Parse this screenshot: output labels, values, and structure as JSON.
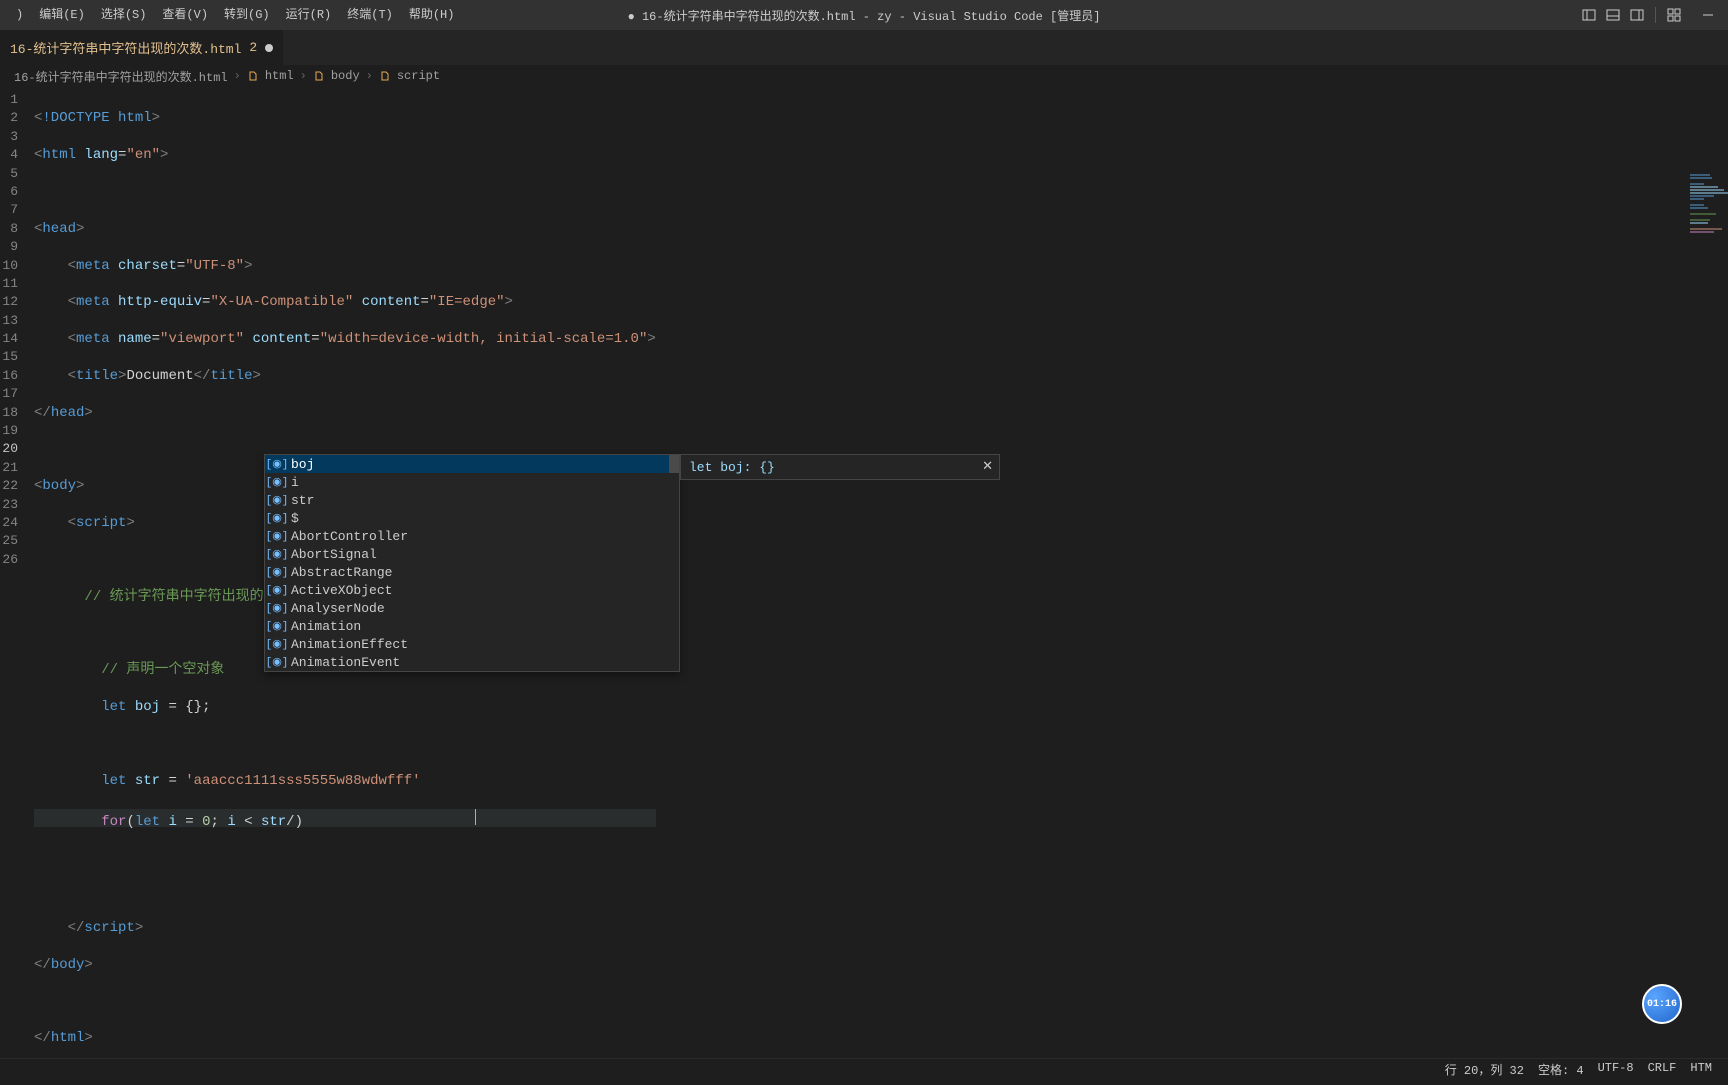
{
  "menu": {
    "items": [
      ")",
      "编辑(E)",
      "选择(S)",
      "查看(V)",
      "转到(G)",
      "运行(R)",
      "终端(T)",
      "帮助(H)"
    ]
  },
  "title": "● 16-统计字符串中字符出现的次数.html - zy - Visual Studio Code [管理员]",
  "tab": {
    "label": "16-统计字符串中字符出现的次数.html",
    "modifiedCount": "2"
  },
  "breadcrumb": {
    "file": "16-统计字符串中字符出现的次数.html",
    "parts": [
      "html",
      "body",
      "script"
    ]
  },
  "lines": [
    "1",
    "2",
    "3",
    "4",
    "5",
    "6",
    "7",
    "8",
    "9",
    "10",
    "11",
    "12",
    "13",
    "14",
    "15",
    "16",
    "17",
    "18",
    "19",
    "20",
    "21",
    "22",
    "23",
    "24",
    "25",
    "26"
  ],
  "code": {
    "doctype": "!DOCTYPE",
    "html": "html",
    "lang": "lang",
    "en": "\"en\"",
    "head": "head",
    "meta": "meta",
    "charset": "charset",
    "utf8": "\"UTF-8\"",
    "httpEquiv": "http-equiv",
    "xua": "\"X-UA-Compatible\"",
    "content": "content",
    "ieedge": "\"IE=edge\"",
    "name": "name",
    "viewport": "\"viewport\"",
    "vpcontent": "\"width=device-width, initial-scale=1.0\"",
    "title": "title",
    "document": "Document",
    "body": "body",
    "script": "script",
    "comment1": "// 统计字符串中字符出现的次数",
    "comment2": "// 声明一个空对象",
    "let": "let",
    "boj": "boj",
    "eqBrace": " = {};",
    "str": "str",
    "strVal": "'aaaccc1111sss5555w88wdwfff'",
    "for": "for",
    "iEq": "i = 0; i < str/",
    "close": ")"
  },
  "suggest": {
    "items": [
      "boj",
      "i",
      "str",
      "$",
      "AbortController",
      "AbortSignal",
      "AbstractRange",
      "ActiveXObject",
      "AnalyserNode",
      "Animation",
      "AnimationEffect",
      "AnimationEvent"
    ],
    "detail": "let boj: {}"
  },
  "status": {
    "lnCol": "行 20，列 32",
    "spaces": "空格: 4",
    "enc": "UTF-8",
    "eol": "CRLF",
    "lang": "HTM"
  },
  "timer": "01:16"
}
